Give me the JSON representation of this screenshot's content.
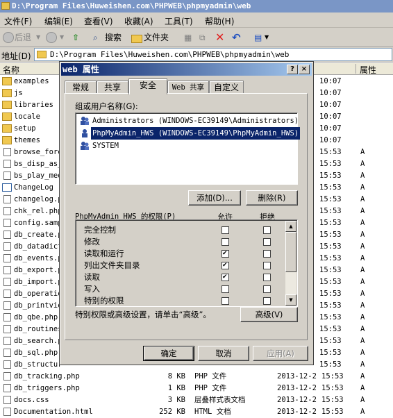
{
  "window": {
    "title": "D:\\Program Files\\Huweishen.com\\PHPWEB\\phpmyadmin\\web"
  },
  "menu": [
    "文件(F)",
    "编辑(E)",
    "查看(V)",
    "收藏(A)",
    "工具(T)",
    "帮助(H)"
  ],
  "toolbar": {
    "back": "后退",
    "search": "搜索",
    "folders": "文件夹"
  },
  "address": {
    "label": "地址(D)",
    "value": "D:\\Program Files\\Huweishen.com\\PHPWEB\\phpmyadmin\\web"
  },
  "columns": {
    "name": "名称",
    "attr": "属性"
  },
  "files": [
    {
      "name": "examples",
      "icon": "folder",
      "date": "",
      "time": "10:07",
      "attr": ""
    },
    {
      "name": "js",
      "icon": "folder",
      "date": "",
      "time": "10:07",
      "attr": ""
    },
    {
      "name": "libraries",
      "icon": "folder",
      "date": "",
      "time": "10:07",
      "attr": ""
    },
    {
      "name": "locale",
      "icon": "folder",
      "date": "",
      "time": "10:07",
      "attr": ""
    },
    {
      "name": "setup",
      "icon": "folder",
      "date": "",
      "time": "10:07",
      "attr": ""
    },
    {
      "name": "themes",
      "icon": "folder",
      "date": "",
      "time": "10:07",
      "attr": ""
    },
    {
      "name": "browse_fore",
      "icon": "file",
      "date": "",
      "time": "15:53",
      "attr": "A"
    },
    {
      "name": "bs_disp_as_",
      "icon": "file",
      "date": "",
      "time": "15:53",
      "attr": "A"
    },
    {
      "name": "bs_play_med",
      "icon": "file",
      "date": "",
      "time": "15:53",
      "attr": "A"
    },
    {
      "name": "ChangeLog",
      "icon": "exe",
      "date": "",
      "time": "15:53",
      "attr": "A"
    },
    {
      "name": "changelog.p",
      "icon": "file",
      "date": "",
      "time": "15:53",
      "attr": "A"
    },
    {
      "name": "chk_rel.php",
      "icon": "file",
      "date": "",
      "time": "15:53",
      "attr": "A"
    },
    {
      "name": "config.samp",
      "icon": "file",
      "date": "",
      "time": "15:53",
      "attr": "A"
    },
    {
      "name": "db_create.p",
      "icon": "file",
      "date": "",
      "time": "15:53",
      "attr": "A"
    },
    {
      "name": "db_datadict",
      "icon": "file",
      "date": "",
      "time": "15:53",
      "attr": "A"
    },
    {
      "name": "db_events.p",
      "icon": "file",
      "date": "",
      "time": "15:53",
      "attr": "A"
    },
    {
      "name": "db_export.p",
      "icon": "file",
      "date": "",
      "time": "15:53",
      "attr": "A"
    },
    {
      "name": "db_import.p",
      "icon": "file",
      "date": "",
      "time": "15:53",
      "attr": "A"
    },
    {
      "name": "db_operatio",
      "icon": "file",
      "date": "",
      "time": "15:53",
      "attr": "A"
    },
    {
      "name": "db_printvie",
      "icon": "file",
      "date": "",
      "time": "15:53",
      "attr": "A"
    },
    {
      "name": "db_qbe.php",
      "icon": "file",
      "date": "",
      "time": "15:53",
      "attr": "A"
    },
    {
      "name": "db_routines",
      "icon": "file",
      "date": "",
      "time": "15:53",
      "attr": "A"
    },
    {
      "name": "db_search.p",
      "icon": "file",
      "date": "",
      "time": "15:53",
      "attr": "A"
    },
    {
      "name": "db_sql.php",
      "icon": "file",
      "date": "",
      "time": "15:53",
      "attr": "A"
    },
    {
      "name": "db_structur",
      "icon": "file",
      "date": "",
      "time": "15:53",
      "attr": "A"
    },
    {
      "name": "db_tracking.php",
      "icon": "file",
      "size": "8 KB",
      "type": "PHP 文件",
      "date": "2013-12-2",
      "time": "15:53",
      "attr": "A"
    },
    {
      "name": "db_triggers.php",
      "icon": "file",
      "size": "1 KB",
      "type": "PHP 文件",
      "date": "2013-12-2",
      "time": "15:53",
      "attr": "A"
    },
    {
      "name": "docs.css",
      "icon": "file",
      "size": "3 KB",
      "type": "层叠样式表文档",
      "date": "2013-12-2",
      "time": "15:53",
      "attr": "A"
    },
    {
      "name": "Documentation.html",
      "icon": "file",
      "size": "252 KB",
      "type": "HTML 文档",
      "date": "2013-12-2",
      "time": "15:53",
      "attr": "A"
    }
  ],
  "dialog": {
    "title": "web 属性",
    "close": "×",
    "help": "?",
    "tabs": [
      "常规",
      "共享",
      "安全",
      "Web 共享",
      "自定义"
    ],
    "active_tab": "安全",
    "group_label": "组或用户名称(G):",
    "groups": [
      {
        "name": "Administrators (WINDOWS-EC39149\\Administrators)",
        "selected": false
      },
      {
        "name": "PhpMyAdmin_HWS (WINDOWS-EC39149\\PhpMyAdmin_HWS)",
        "selected": true
      },
      {
        "name": "SYSTEM",
        "selected": false
      }
    ],
    "add_button": "添加(D)...",
    "remove_button": "删除(R)",
    "perm_header": "PhpMyAdmin_HWS 的权限(P)",
    "allow": "允许",
    "deny": "拒绝",
    "permissions": [
      {
        "name": "完全控制",
        "allow": false,
        "deny": false
      },
      {
        "name": "修改",
        "allow": false,
        "deny": false
      },
      {
        "name": "读取和运行",
        "allow": true,
        "deny": false
      },
      {
        "name": "列出文件夹目录",
        "allow": true,
        "deny": false
      },
      {
        "name": "读取",
        "allow": true,
        "deny": false
      },
      {
        "name": "写入",
        "allow": false,
        "deny": false
      },
      {
        "name": "特别的权限",
        "allow": false,
        "deny": false
      }
    ],
    "special_text": "特别权限或高级设置，请单击“高级”。",
    "advanced_button": "高级(V)",
    "ok": "确定",
    "cancel": "取消",
    "apply": "应用(A)"
  }
}
